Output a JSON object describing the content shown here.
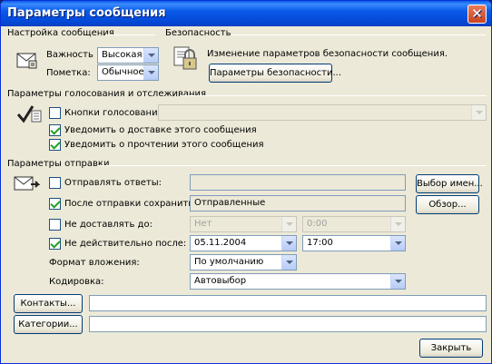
{
  "window": {
    "title": "Параметры сообщения",
    "close_glyph": "✕"
  },
  "message_settings": {
    "group_title": "Настройка сообщения",
    "importance_label": "Важность",
    "importance_value": "Высокая",
    "sensitivity_label": "Пометка:",
    "sensitivity_value": "Обычное"
  },
  "security": {
    "group_title": "Безопасность",
    "description": "Изменение параметров безопасности сообщения.",
    "settings_button": "Параметры безопасности..."
  },
  "voting": {
    "group_title": "Параметры голосования и отслеживания",
    "voting_buttons_label": "Кнопки голосования:",
    "voting_buttons_checked": false,
    "voting_buttons_value": "",
    "delivery_receipt_label": "Уведомить о доставке этого сообщения",
    "delivery_receipt_checked": true,
    "read_receipt_label": "Уведомить о прочтении этого сообщения",
    "read_receipt_checked": true
  },
  "delivery": {
    "group_title": "Параметры отправки",
    "replies_label": "Отправлять ответы:",
    "replies_checked": false,
    "replies_value": "",
    "select_names_button": "Выбор имен...",
    "save_sent_label": "После отправки сохранить в:",
    "save_sent_checked": true,
    "save_sent_value": "Отправленные",
    "browse_button": "Обзор...",
    "do_not_deliver_label": "Не доставлять до:",
    "do_not_deliver_checked": false,
    "do_not_deliver_date": "Нет",
    "do_not_deliver_time": "0:00",
    "expires_label": "Не действительно после:",
    "expires_checked": true,
    "expires_date": "05.11.2004",
    "expires_time": "17:00",
    "attachment_format_label": "Формат вложения:",
    "attachment_format_value": "По умолчанию",
    "encoding_label": "Кодировка:",
    "encoding_value": "Автовыбор"
  },
  "contacts_button": "Контакты...",
  "contacts_value": "",
  "categories_button": "Категории...",
  "categories_value": "",
  "close_button": "Закрыть"
}
